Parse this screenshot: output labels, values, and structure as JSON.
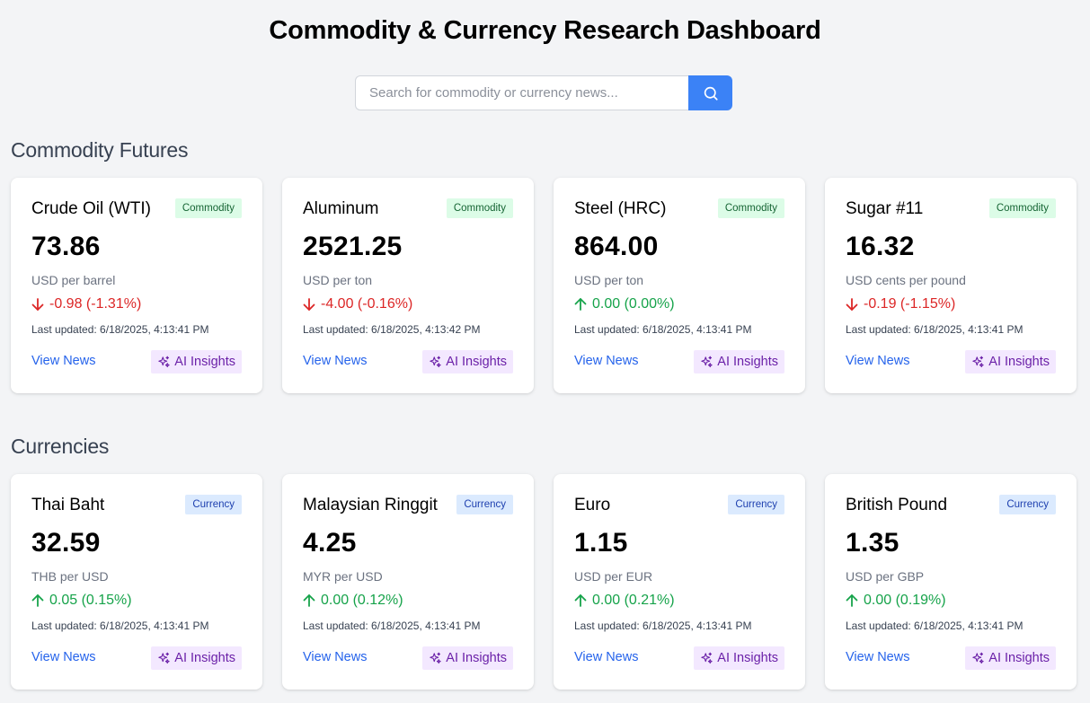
{
  "header": {
    "title": "Commodity & Currency Research Dashboard"
  },
  "search": {
    "placeholder": "Search for commodity or currency news..."
  },
  "sections": [
    {
      "title": "Commodity Futures",
      "cards": [
        {
          "name": "Crude Oil (WTI)",
          "badge": "Commodity",
          "price": "73.86",
          "unit": "USD per barrel",
          "change": "-0.98 (-1.31%)",
          "direction": "down",
          "updated": "Last updated: 6/18/2025, 4:13:41 PM",
          "news": "View News",
          "ai": "AI Insights"
        },
        {
          "name": "Aluminum",
          "badge": "Commodity",
          "price": "2521.25",
          "unit": "USD per ton",
          "change": "-4.00 (-0.16%)",
          "direction": "down",
          "updated": "Last updated: 6/18/2025, 4:13:42 PM",
          "news": "View News",
          "ai": "AI Insights"
        },
        {
          "name": "Steel (HRC)",
          "badge": "Commodity",
          "price": "864.00",
          "unit": "USD per ton",
          "change": "0.00 (0.00%)",
          "direction": "up",
          "updated": "Last updated: 6/18/2025, 4:13:41 PM",
          "news": "View News",
          "ai": "AI Insights"
        },
        {
          "name": "Sugar #11",
          "badge": "Commodity",
          "price": "16.32",
          "unit": "USD cents per pound",
          "change": "-0.19 (-1.15%)",
          "direction": "down",
          "updated": "Last updated: 6/18/2025, 4:13:41 PM",
          "news": "View News",
          "ai": "AI Insights"
        }
      ]
    },
    {
      "title": "Currencies",
      "cards": [
        {
          "name": "Thai Baht",
          "badge": "Currency",
          "price": "32.59",
          "unit": "THB per USD",
          "change": "0.05 (0.15%)",
          "direction": "up",
          "updated": "Last updated: 6/18/2025, 4:13:41 PM",
          "news": "View News",
          "ai": "AI Insights"
        },
        {
          "name": "Malaysian Ringgit",
          "badge": "Currency",
          "price": "4.25",
          "unit": "MYR per USD",
          "change": "0.00 (0.12%)",
          "direction": "up",
          "updated": "Last updated: 6/18/2025, 4:13:41 PM",
          "news": "View News",
          "ai": "AI Insights"
        },
        {
          "name": "Euro",
          "badge": "Currency",
          "price": "1.15",
          "unit": "USD per EUR",
          "change": "0.00 (0.21%)",
          "direction": "up",
          "updated": "Last updated: 6/18/2025, 4:13:41 PM",
          "news": "View News",
          "ai": "AI Insights"
        },
        {
          "name": "British Pound",
          "badge": "Currency",
          "price": "1.35",
          "unit": "USD per GBP",
          "change": "0.00 (0.19%)",
          "direction": "up",
          "updated": "Last updated: 6/18/2025, 4:13:41 PM",
          "news": "View News",
          "ai": "AI Insights"
        }
      ]
    }
  ],
  "colors": {
    "accent": "#3b82f6",
    "up": "#16a34a",
    "down": "#dc2626",
    "link": "#2563eb",
    "ai": "#6b21a8"
  },
  "icons": {
    "search": "search-icon",
    "up": "arrow-up-icon",
    "down": "arrow-down-icon",
    "ai": "sparkles-icon"
  }
}
